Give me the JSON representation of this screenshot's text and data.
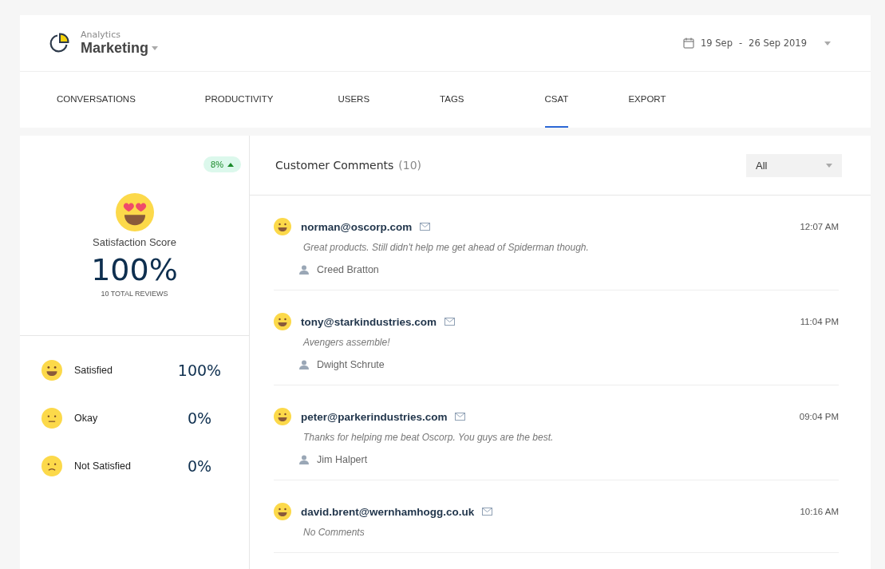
{
  "header": {
    "app": "Analytics",
    "title": "Marketing",
    "date_from": "19 Sep",
    "date_sep": "-",
    "date_to": "26 Sep 2019"
  },
  "tabs": [
    {
      "label": "CONVERSATIONS",
      "selected": false
    },
    {
      "label": "PRODUCTIVITY",
      "selected": false
    },
    {
      "label": "USERS",
      "selected": false
    },
    {
      "label": "TAGS",
      "selected": false
    },
    {
      "label": "CSAT",
      "selected": true
    },
    {
      "label": "EXPORT",
      "selected": false
    }
  ],
  "score": {
    "change": "8%",
    "trend_up": true,
    "kind": "love",
    "label": "Satisfaction Score",
    "value": "100%",
    "total": "10 TOTAL REVIEWS"
  },
  "breakdown": [
    {
      "kind": "happy",
      "label": "Satisfied",
      "value": "100%"
    },
    {
      "kind": "neutral",
      "label": "Okay",
      "value": "0%"
    },
    {
      "kind": "sad",
      "label": "Not Satisfied",
      "value": "0%"
    }
  ],
  "comments_panel": {
    "title": "Customer Comments",
    "count": "(10)",
    "filter": "All"
  },
  "comments": [
    {
      "kind": "happy",
      "email": "norman@oscorp.com",
      "time": "12:07 AM",
      "text": "Great products. Still didn't help me get ahead of Spiderman though.",
      "user": "Creed Bratton"
    },
    {
      "kind": "happy",
      "email": "tony@starkindustries.com",
      "time": "11:04 PM",
      "text": "Avengers assemble!",
      "user": "Dwight Schrute"
    },
    {
      "kind": "happy",
      "email": "peter@parkerindustries.com",
      "time": "09:04 PM",
      "text": "Thanks for helping me beat Oscorp. You guys are the best.",
      "user": "Jim Halpert"
    },
    {
      "kind": "happy",
      "email": "david.brent@wernhamhogg.co.uk",
      "time": "10:16 AM",
      "text": "No Comments"
    }
  ]
}
